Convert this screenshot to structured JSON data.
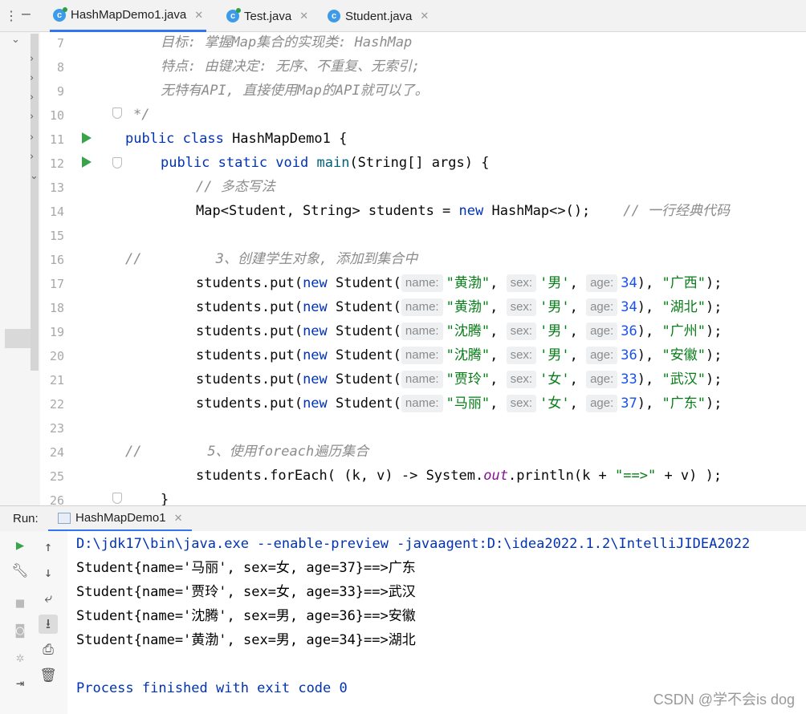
{
  "tabs": [
    {
      "label": "HashMapDemo1.java",
      "icon": "java-class-icon",
      "active": true
    },
    {
      "label": "Test.java",
      "icon": "java-class-icon",
      "active": false
    },
    {
      "label": "Student.java",
      "icon": "java-class-icon",
      "active": false
    }
  ],
  "editor": {
    "line_numbers": [
      "7",
      "8",
      "9",
      "10",
      "11",
      "12",
      "13",
      "14",
      "15",
      "16",
      "17",
      "18",
      "19",
      "20",
      "21",
      "22",
      "23",
      "24",
      "25",
      "26"
    ],
    "lines": {
      "l7": "目标: 掌握Map集合的实现类: HashMap",
      "l8": "特点: 由键决定: 无序、不重复、无索引;",
      "l9": "无特有API, 直接使用Map的API就可以了。",
      "l10": "*/",
      "l11_kw": "public class",
      "l11_rest": " HashMapDemo1 {",
      "l12_kw": "public static void",
      "l12_method": "main",
      "l12_rest": "(String[] args) {",
      "l13": "// 多态写法",
      "l14_a": "Map<Student, String> students = ",
      "l14_kw": "new",
      "l14_b": " HashMap<>();",
      "l14_cm": "// 一行经典代码",
      "l16": "//         3、创建学生对象, 添加到集合中",
      "l24": "//        5、使用foreach遍历集合",
      "l25_a": "students.forEach( (k, v) -> System.",
      "l25_field": "out",
      "l25_b": ".println(k + ",
      "l25_str": "\"==>\"",
      "l25_c": " + v) );",
      "l26": "}"
    },
    "put_prefix": "students.put(",
    "put_new": "new",
    "put_class": " Student(",
    "hint_name": "name:",
    "hint_sex": "sex:",
    "hint_age": "age:",
    "puts": [
      {
        "name": "\"黄渤\"",
        "sex": "'男'",
        "age": "34",
        "city": "\"广西\""
      },
      {
        "name": "\"黄渤\"",
        "sex": "'男'",
        "age": "34",
        "city": "\"湖北\""
      },
      {
        "name": "\"沈腾\"",
        "sex": "'男'",
        "age": "36",
        "city": "\"广州\""
      },
      {
        "name": "\"沈腾\"",
        "sex": "'男'",
        "age": "36",
        "city": "\"安徽\""
      },
      {
        "name": "\"贾玲\"",
        "sex": "'女'",
        "age": "33",
        "city": "\"武汉\""
      },
      {
        "name": "\"马丽\"",
        "sex": "'女'",
        "age": "37",
        "city": "\"广东\""
      }
    ]
  },
  "run": {
    "label": "Run:",
    "tab_label": "HashMapDemo1",
    "console": {
      "command": "D:\\jdk17\\bin\\java.exe --enable-preview -javaagent:D:\\idea2022.1.2\\IntelliJIDEA2022",
      "output": [
        "Student{name='马丽', sex=女, age=37}==>广东",
        "Student{name='贾玲', sex=女, age=33}==>武汉",
        "Student{name='沈腾', sex=男, age=36}==>安徽",
        "Student{name='黄渤', sex=男, age=34}==>湖北"
      ],
      "finish": "Process finished with exit code 0"
    }
  },
  "watermark": "CSDN @学不会is dog",
  "colors": {
    "keyword": "#0033b3",
    "string": "#067d17",
    "number": "#1750eb",
    "comment": "#8c8c8c",
    "run_green": "#3aa24a",
    "accent": "#3574f0"
  }
}
